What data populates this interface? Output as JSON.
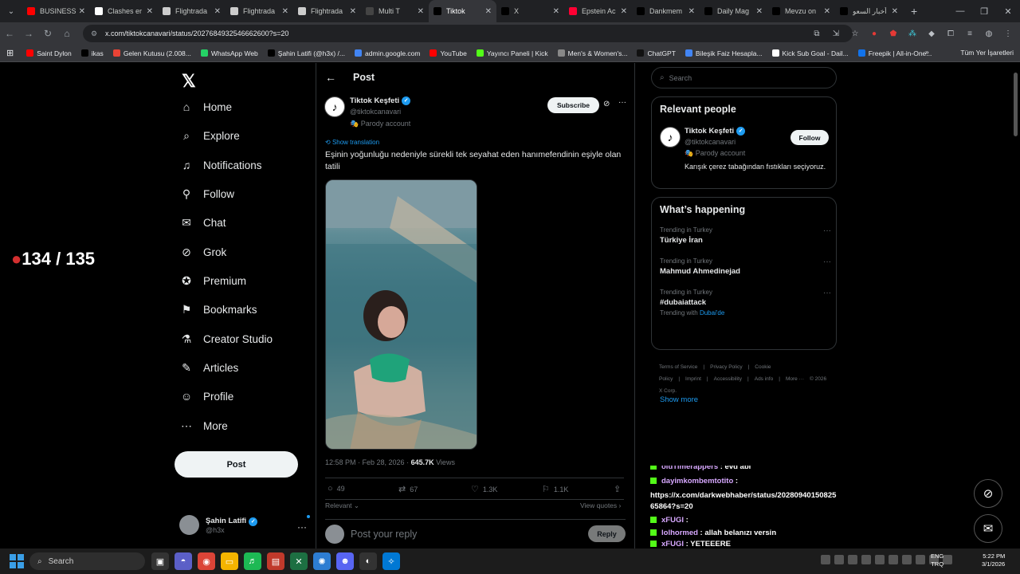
{
  "browser": {
    "tabs": [
      {
        "label": "BUSINESS",
        "color": "#ff0000"
      },
      {
        "label": "Clashes er",
        "color": "#ffffff"
      },
      {
        "label": "Flightrada",
        "color": "#cccccc"
      },
      {
        "label": "Flightrada",
        "color": "#cccccc"
      },
      {
        "label": "Flightrada",
        "color": "#cccccc"
      },
      {
        "label": "Multi T",
        "color": "#444444"
      },
      {
        "label": "Tiktok",
        "color": "#000000"
      },
      {
        "label": "X",
        "color": "#000000"
      },
      {
        "label": "Epstein Ac",
        "color": "#ff0033"
      },
      {
        "label": "Dankmem",
        "color": "#000000"
      },
      {
        "label": "Daily Mag",
        "color": "#000000"
      },
      {
        "label": "Mevzu on",
        "color": "#000000"
      },
      {
        "label": "أخبار السعو",
        "color": "#000000"
      }
    ],
    "url": "x.com/tiktokcanavari/status/2027684932546662600?s=20",
    "bookmarks": [
      {
        "label": "Saint Dylon",
        "color": "#ff0000"
      },
      {
        "label": "ikas",
        "color": "#000000"
      },
      {
        "label": "Gelen Kutusu (2.008...",
        "color": "#ea4335"
      },
      {
        "label": "WhatsApp Web",
        "color": "#25d366"
      },
      {
        "label": "Şahin Latifi (@h3x) /...",
        "color": "#000000"
      },
      {
        "label": "admin.google.com",
        "color": "#4285f4"
      },
      {
        "label": "YouTube",
        "color": "#ff0000"
      },
      {
        "label": "Yayıncı Paneli | Kick",
        "color": "#53fc18"
      },
      {
        "label": "Men's & Women's...",
        "color": "#888888"
      },
      {
        "label": "ChatGPT",
        "color": "#111111"
      },
      {
        "label": "Bileşik Faiz Hesapla...",
        "color": "#4285f4"
      },
      {
        "label": "Kick Sub Goal - Dail...",
        "color": "#ffffff"
      },
      {
        "label": "Freepik | All-in-One...",
        "color": "#1273eb"
      }
    ],
    "all_bookmarks": "Tüm Yer İşaretleri"
  },
  "overlay": {
    "counter": "134 / 135"
  },
  "nav": {
    "items": [
      {
        "label": "Home",
        "icon": "home-icon",
        "glyph": "⌂"
      },
      {
        "label": "Explore",
        "icon": "search-icon",
        "glyph": "⌕"
      },
      {
        "label": "Notifications",
        "icon": "bell-icon",
        "glyph": "♫"
      },
      {
        "label": "Follow",
        "icon": "person-plus-icon",
        "glyph": "⚲"
      },
      {
        "label": "Chat",
        "icon": "mail-icon",
        "glyph": "✉"
      },
      {
        "label": "Grok",
        "icon": "grok-icon",
        "glyph": "⊘"
      },
      {
        "label": "Premium",
        "icon": "premium-icon",
        "glyph": "✪"
      },
      {
        "label": "Bookmarks",
        "icon": "bookmark-icon",
        "glyph": "⚑"
      },
      {
        "label": "Creator Studio",
        "icon": "flask-icon",
        "glyph": "⚗"
      },
      {
        "label": "Articles",
        "icon": "article-icon",
        "glyph": "✎"
      },
      {
        "label": "Profile",
        "icon": "person-icon",
        "glyph": "☺"
      },
      {
        "label": "More",
        "icon": "more-circle-icon",
        "glyph": "⋯"
      }
    ],
    "post_button": "Post",
    "account": {
      "name": "Şahin Latifi",
      "handle": "@h3x"
    }
  },
  "post": {
    "header": "Post",
    "author": {
      "name": "Tiktok Keşfeti",
      "handle": "@tiktokcanavari",
      "badge": "Parody account"
    },
    "subscribe": "Subscribe",
    "show_translation": "Show translation",
    "text": "Eşinin yoğunluğu nedeniyle sürekli tek seyahat eden hanımefendinin eşiyle olan tatili",
    "time": "12:58 PM · Feb 28, 2026 · ",
    "views": "645.7K",
    "views_label": " Views",
    "replies": "49",
    "reposts": "67",
    "likes": "1.3K",
    "bookmarks": "1.1K",
    "relevant": "Relevant ⌄",
    "view_quotes": "View quotes ›",
    "reply_placeholder": "Post your reply",
    "reply_button": "Reply"
  },
  "sidebar": {
    "search_placeholder": "Search",
    "relevant_title": "Relevant people",
    "person": {
      "name": "Tiktok Keşfeti",
      "handle": "@tiktokcanavari",
      "badge": "Parody account",
      "bio": "Karışık çerez tabağından fıstıkları seçiyoruz.",
      "follow": "Follow"
    },
    "happening_title": "What’s happening",
    "trends": [
      {
        "context": "Trending in Turkey",
        "name": "Türkiye İran",
        "with": "",
        "with_link": ""
      },
      {
        "context": "Trending in Turkey",
        "name": "Mahmud Ahmedinejad",
        "with": "",
        "with_link": ""
      },
      {
        "context": "Trending in Turkey",
        "name": "#dubaiattack",
        "with": "Trending with ",
        "with_link": "Dubai'de"
      }
    ],
    "show_more": "Show more",
    "footer": [
      "Terms of Service",
      "|",
      "Privacy Policy",
      "|",
      "Cookie Policy",
      "|",
      "Imprint",
      "|",
      "Accessibility",
      "|",
      "Ads info",
      "|",
      "More ···",
      "© 2026 X Corp."
    ]
  },
  "chat_overlay": [
    {
      "user": "oldTimerappers",
      "msg": " : evd abi"
    },
    {
      "user": "dayimkombemtotito",
      "msg": " :"
    },
    {
      "user": "",
      "msg": "https://x.com/darkwebhaber/status/20280940150825"
    },
    {
      "user": "",
      "msg": "65864?s=20"
    },
    {
      "user": "xFUGI",
      "msg": " :"
    },
    {
      "user": "lolhormed",
      "msg": " : allah belanızı versin"
    },
    {
      "user": "xFUGI",
      "msg": " : YETEEERE"
    }
  ],
  "taskbar": {
    "search_placeholder": "Search",
    "lang": "ENG\nTRQ",
    "time": "5:22 PM",
    "date": "3/1/2026"
  }
}
